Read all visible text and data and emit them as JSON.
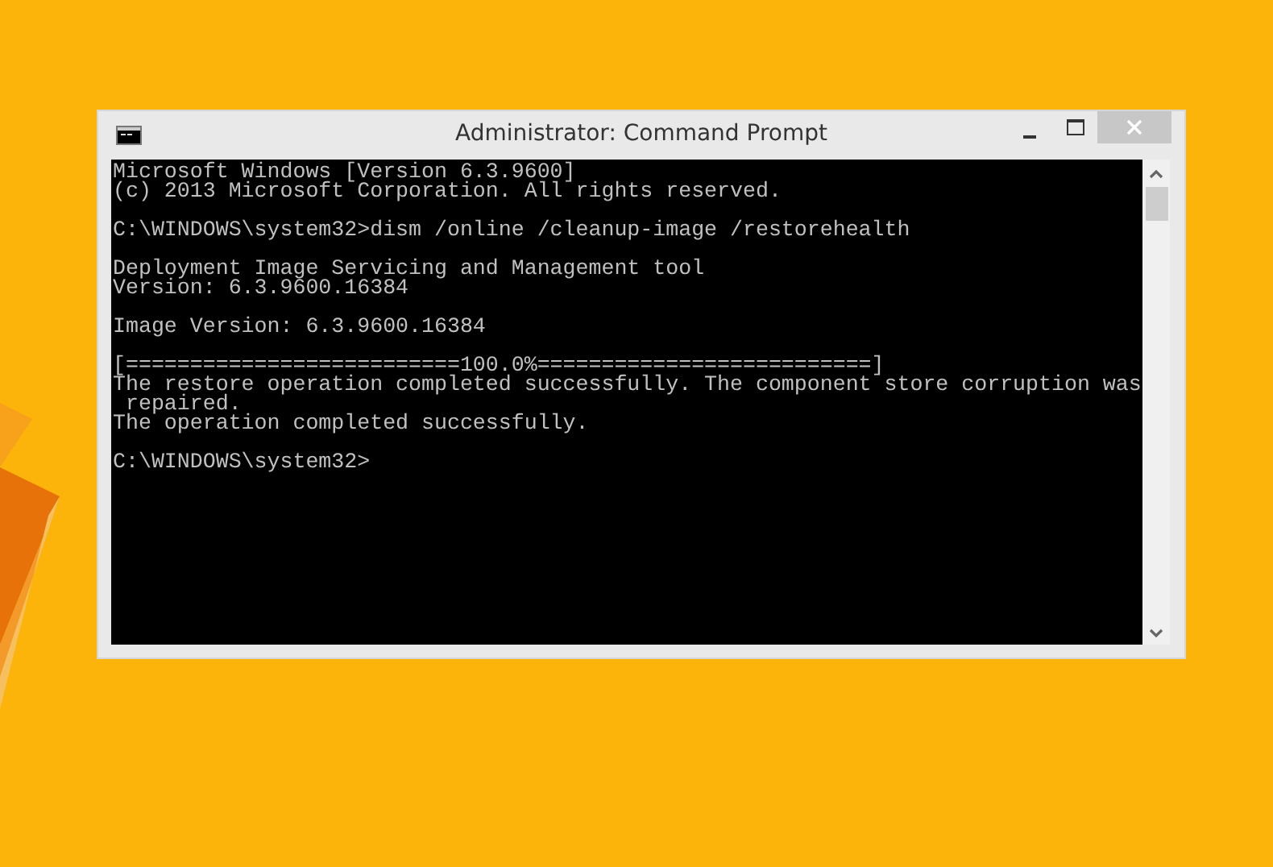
{
  "window": {
    "title": "Administrator: Command Prompt"
  },
  "console": {
    "blocks": [
      [
        "Microsoft Windows [Version 6.3.9600]",
        "(c) 2013 Microsoft Corporation. All rights reserved."
      ],
      [
        "C:\\WINDOWS\\system32>dism /online /cleanup-image /restorehealth"
      ],
      [
        "Deployment Image Servicing and Management tool",
        "Version: 6.3.9600.16384"
      ],
      [
        "Image Version: 6.3.9600.16384"
      ],
      [
        "[==========================100.0%==========================]",
        "The restore operation completed successfully. The component store corruption was",
        " repaired.",
        "The operation completed successfully."
      ],
      [
        "C:\\WINDOWS\\system32>"
      ]
    ]
  }
}
